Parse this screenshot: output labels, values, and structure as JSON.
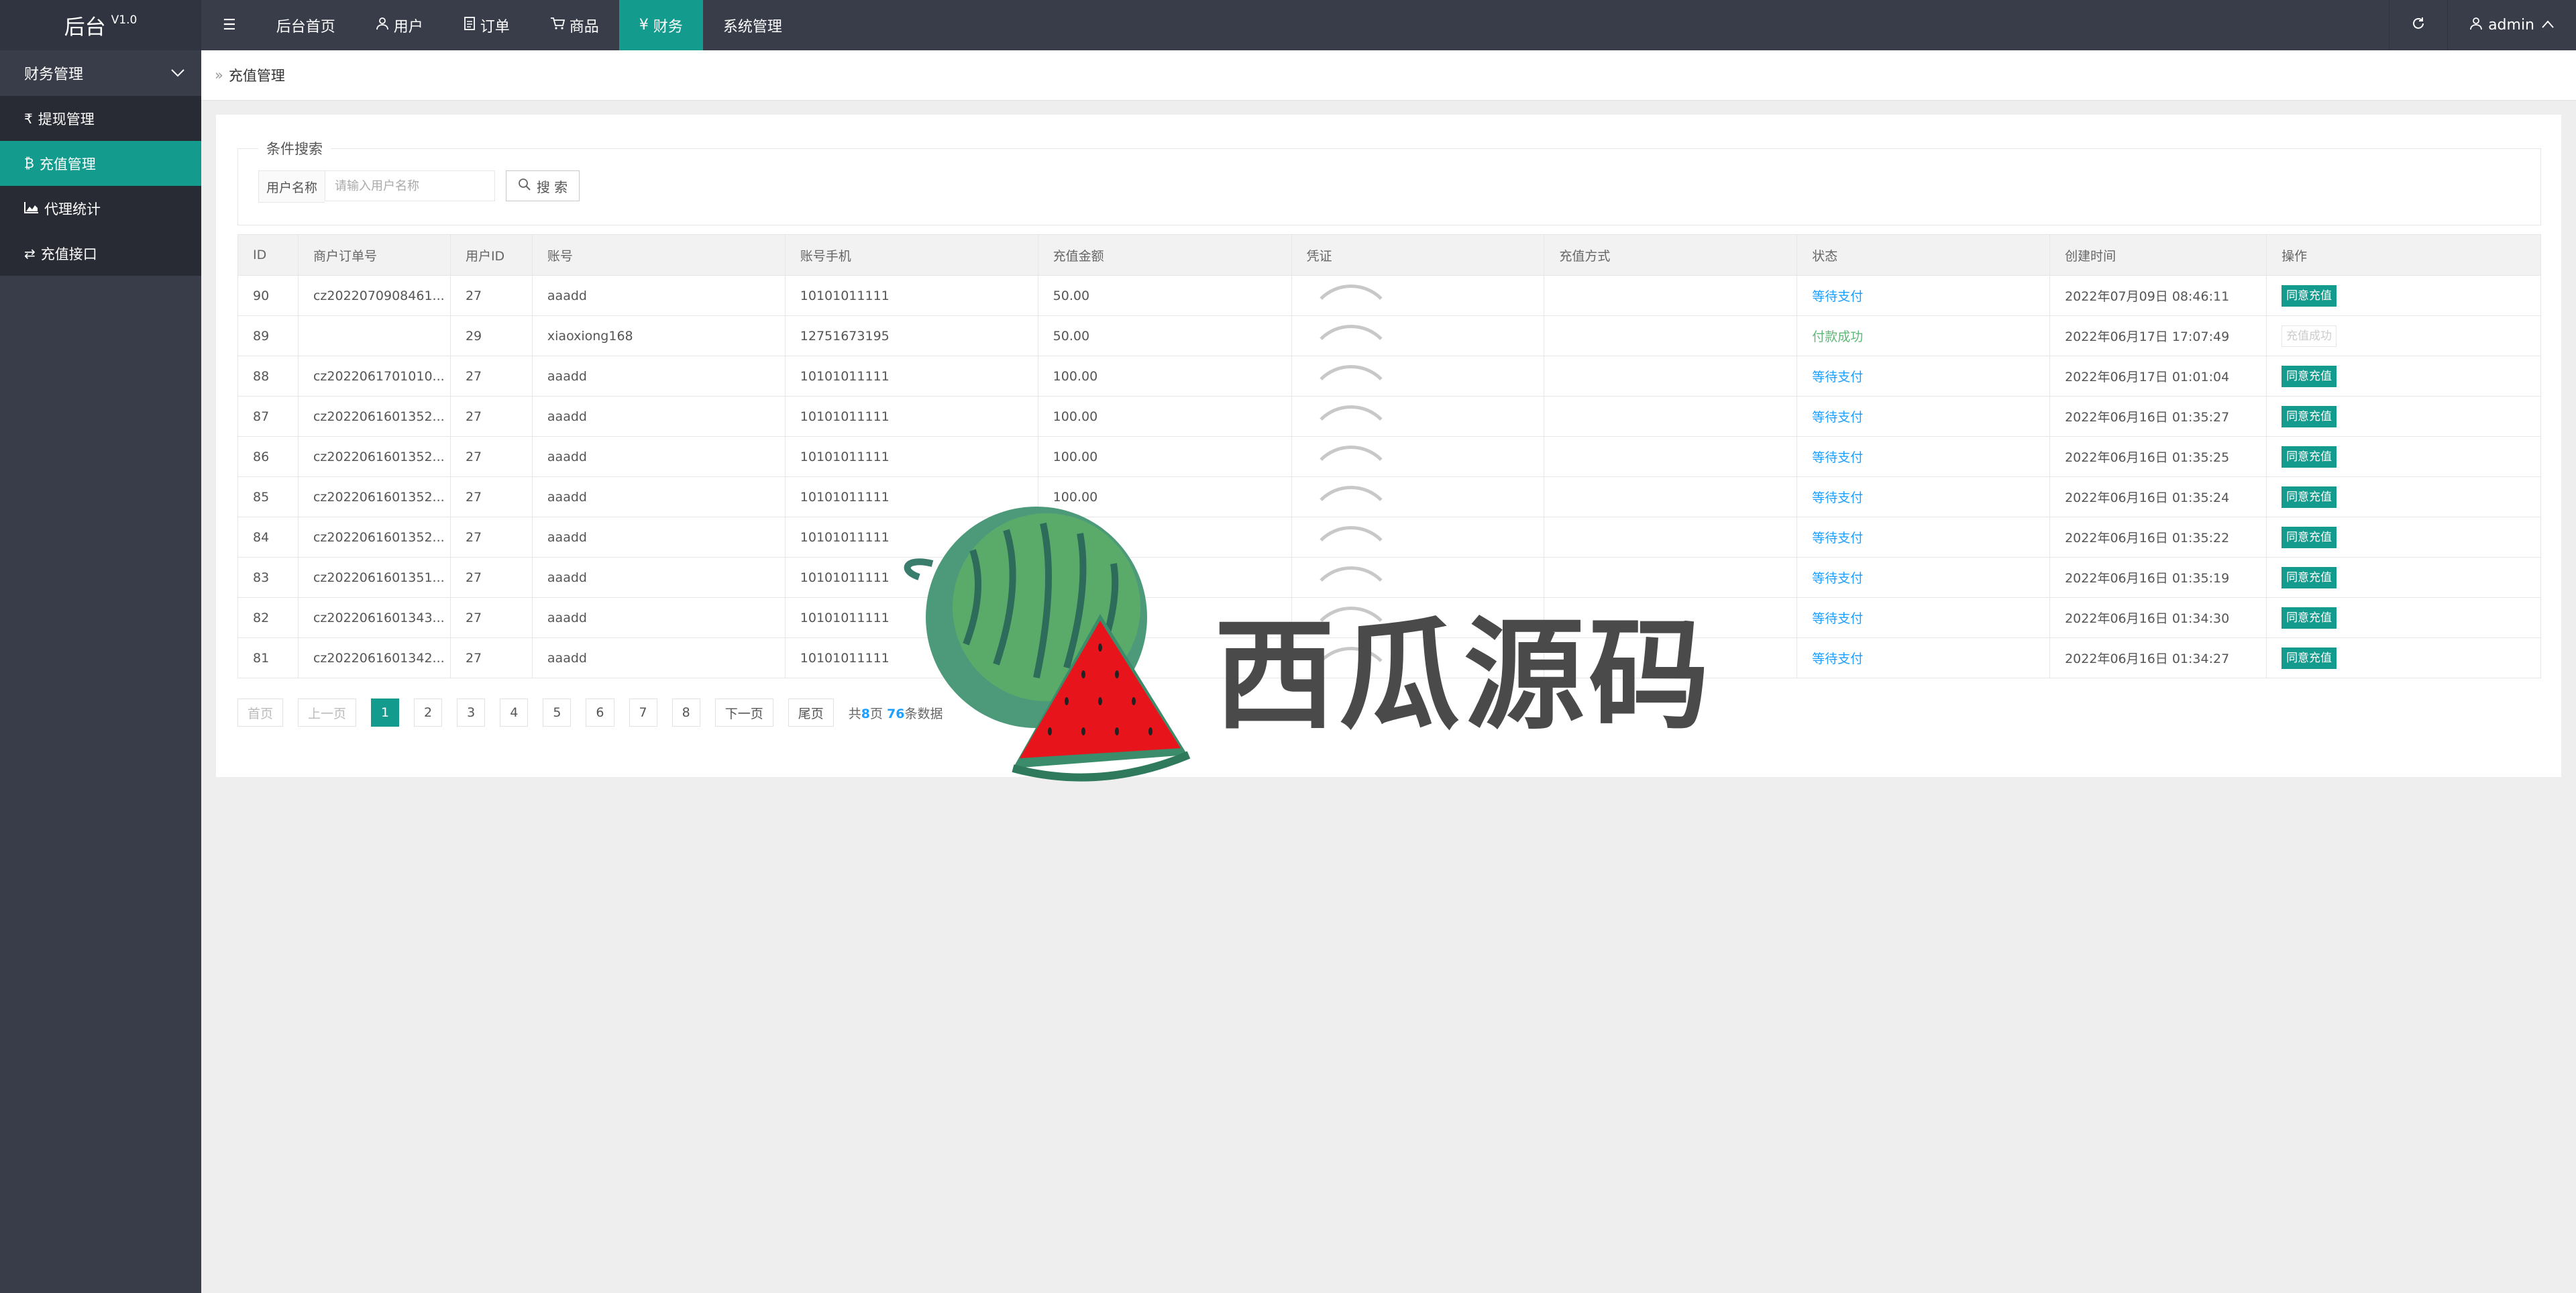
{
  "app": {
    "title": "后台",
    "version": "V1.0"
  },
  "nav": [
    {
      "label": "后台首页",
      "icon": ""
    },
    {
      "label": "用户",
      "icon": "user-icon"
    },
    {
      "label": "订单",
      "icon": "document-icon"
    },
    {
      "label": "商品",
      "icon": "cart-icon"
    },
    {
      "label": "财务",
      "icon": "yen-icon"
    },
    {
      "label": "系统管理",
      "icon": ""
    }
  ],
  "user": {
    "name": "admin"
  },
  "sidebar": {
    "group": "财务管理",
    "items": [
      {
        "label": "提现管理",
        "icon": "rupee-icon"
      },
      {
        "label": "充值管理",
        "icon": "bitcoin-icon"
      },
      {
        "label": "代理统计",
        "icon": "area-chart-icon"
      },
      {
        "label": "充值接口",
        "icon": "exchange-icon"
      }
    ]
  },
  "breadcrumb": "充值管理",
  "search": {
    "legend": "条件搜索",
    "field_label": "用户名称",
    "placeholder": "请输入用户名称",
    "button": "搜 索"
  },
  "table": {
    "headers": [
      "ID",
      "商户订单号",
      "用户ID",
      "账号",
      "账号手机",
      "充值金额",
      "凭证",
      "充值方式",
      "状态",
      "创建时间",
      "操作"
    ],
    "rows": [
      {
        "id": "90",
        "order": "cz2022070908461...",
        "uid": "27",
        "account": "aaadd",
        "phone": "10101011111",
        "amount": "50.00",
        "method": "",
        "status": "等待支付",
        "created": "2022年07月09日 08:46:11",
        "op": "同意充值"
      },
      {
        "id": "89",
        "order": "",
        "uid": "29",
        "account": "xiaoxiong168",
        "phone": "12751673195",
        "amount": "50.00",
        "method": "",
        "status": "付款成功",
        "created": "2022年06月17日 17:07:49",
        "op": "充值成功"
      },
      {
        "id": "88",
        "order": "cz2022061701010...",
        "uid": "27",
        "account": "aaadd",
        "phone": "10101011111",
        "amount": "100.00",
        "method": "",
        "status": "等待支付",
        "created": "2022年06月17日 01:01:04",
        "op": "同意充值"
      },
      {
        "id": "87",
        "order": "cz2022061601352...",
        "uid": "27",
        "account": "aaadd",
        "phone": "10101011111",
        "amount": "100.00",
        "method": "",
        "status": "等待支付",
        "created": "2022年06月16日 01:35:27",
        "op": "同意充值"
      },
      {
        "id": "86",
        "order": "cz2022061601352...",
        "uid": "27",
        "account": "aaadd",
        "phone": "10101011111",
        "amount": "100.00",
        "method": "",
        "status": "等待支付",
        "created": "2022年06月16日 01:35:25",
        "op": "同意充值"
      },
      {
        "id": "85",
        "order": "cz2022061601352...",
        "uid": "27",
        "account": "aaadd",
        "phone": "10101011111",
        "amount": "100.00",
        "method": "",
        "status": "等待支付",
        "created": "2022年06月16日 01:35:24",
        "op": "同意充值"
      },
      {
        "id": "84",
        "order": "cz2022061601352...",
        "uid": "27",
        "account": "aaadd",
        "phone": "10101011111",
        "amount": "",
        "method": "",
        "status": "等待支付",
        "created": "2022年06月16日 01:35:22",
        "op": "同意充值"
      },
      {
        "id": "83",
        "order": "cz2022061601351...",
        "uid": "27",
        "account": "aaadd",
        "phone": "10101011111",
        "amount": "",
        "method": "",
        "status": "等待支付",
        "created": "2022年06月16日 01:35:19",
        "op": "同意充值"
      },
      {
        "id": "82",
        "order": "cz2022061601343...",
        "uid": "27",
        "account": "aaadd",
        "phone": "10101011111",
        "amount": "",
        "method": "",
        "status": "等待支付",
        "created": "2022年06月16日 01:34:30",
        "op": "同意充值"
      },
      {
        "id": "81",
        "order": "cz2022061601342...",
        "uid": "27",
        "account": "aaadd",
        "phone": "10101011111",
        "amount": "",
        "method": "",
        "status": "等待支付",
        "created": "2022年06月16日 01:34:27",
        "op": "同意充值"
      }
    ]
  },
  "pager": {
    "first": "首页",
    "prev": "上一页",
    "pages": [
      "1",
      "2",
      "3",
      "4",
      "5",
      "6",
      "7",
      "8"
    ],
    "current": "1",
    "next": "下一页",
    "last": "尾页",
    "info_prefix": "共",
    "total_pages": "8",
    "info_mid": "页 ",
    "total_records": "76",
    "info_suffix": "条数据"
  },
  "watermark": {
    "text": "西瓜源码"
  },
  "colors": {
    "accent": "#139b8e",
    "link": "#1e9fff",
    "success": "#5fb878",
    "topbar": "#383d49"
  }
}
